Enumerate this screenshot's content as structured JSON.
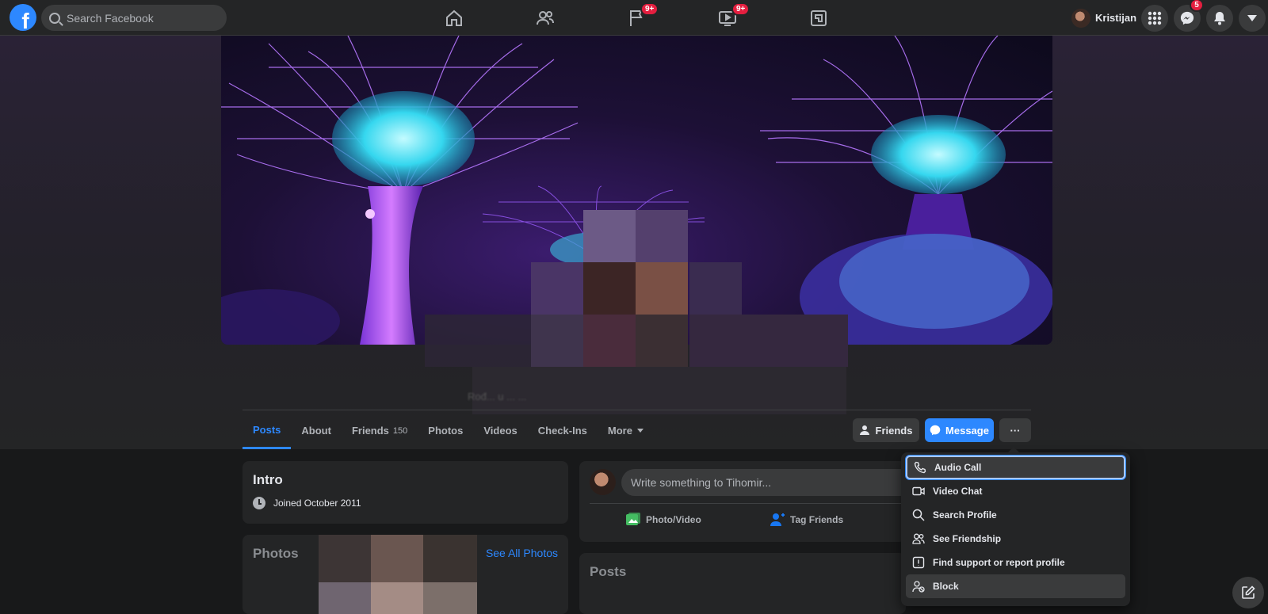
{
  "topbar": {
    "search_placeholder": "Search Facebook",
    "nav": [
      {
        "name": "home-icon"
      },
      {
        "name": "friends-icon"
      },
      {
        "name": "pages-icon",
        "badge": "9+"
      },
      {
        "name": "watch-icon",
        "badge": "9+"
      },
      {
        "name": "gaming-icon"
      }
    ],
    "user_name": "Kristijan",
    "messenger_badge": "5"
  },
  "profile": {
    "blurred_bio": "Rođ... u ... ...",
    "tabs": {
      "posts": "Posts",
      "about": "About",
      "friends": "Friends",
      "friends_count": "150",
      "photos": "Photos",
      "videos": "Videos",
      "checkins": "Check-Ins",
      "more": "More"
    },
    "actions": {
      "friends": "Friends",
      "message": "Message",
      "more": "···"
    }
  },
  "intro": {
    "title": "Intro",
    "joined": "Joined October 2011"
  },
  "photos": {
    "title": "Photos",
    "see_all": "See All Photos"
  },
  "composer": {
    "placeholder": "Write something to Tihomir...",
    "photo_video": "Photo/Video",
    "tag_friends": "Tag Friends"
  },
  "posts": {
    "title": "Posts"
  },
  "menu": {
    "items": [
      {
        "label": "Audio Call",
        "icon": "phone-icon"
      },
      {
        "label": "Video Chat",
        "icon": "video-camera-icon"
      },
      {
        "label": "Search Profile",
        "icon": "search-icon"
      },
      {
        "label": "See Friendship",
        "icon": "people-icon"
      },
      {
        "label": "Find support or report profile",
        "icon": "report-icon"
      },
      {
        "label": "Block",
        "icon": "block-user-icon"
      }
    ]
  },
  "colors": {
    "accent": "#2d88ff",
    "background": "#18191a",
    "surface": "#242526",
    "badge": "#e41e3f"
  }
}
